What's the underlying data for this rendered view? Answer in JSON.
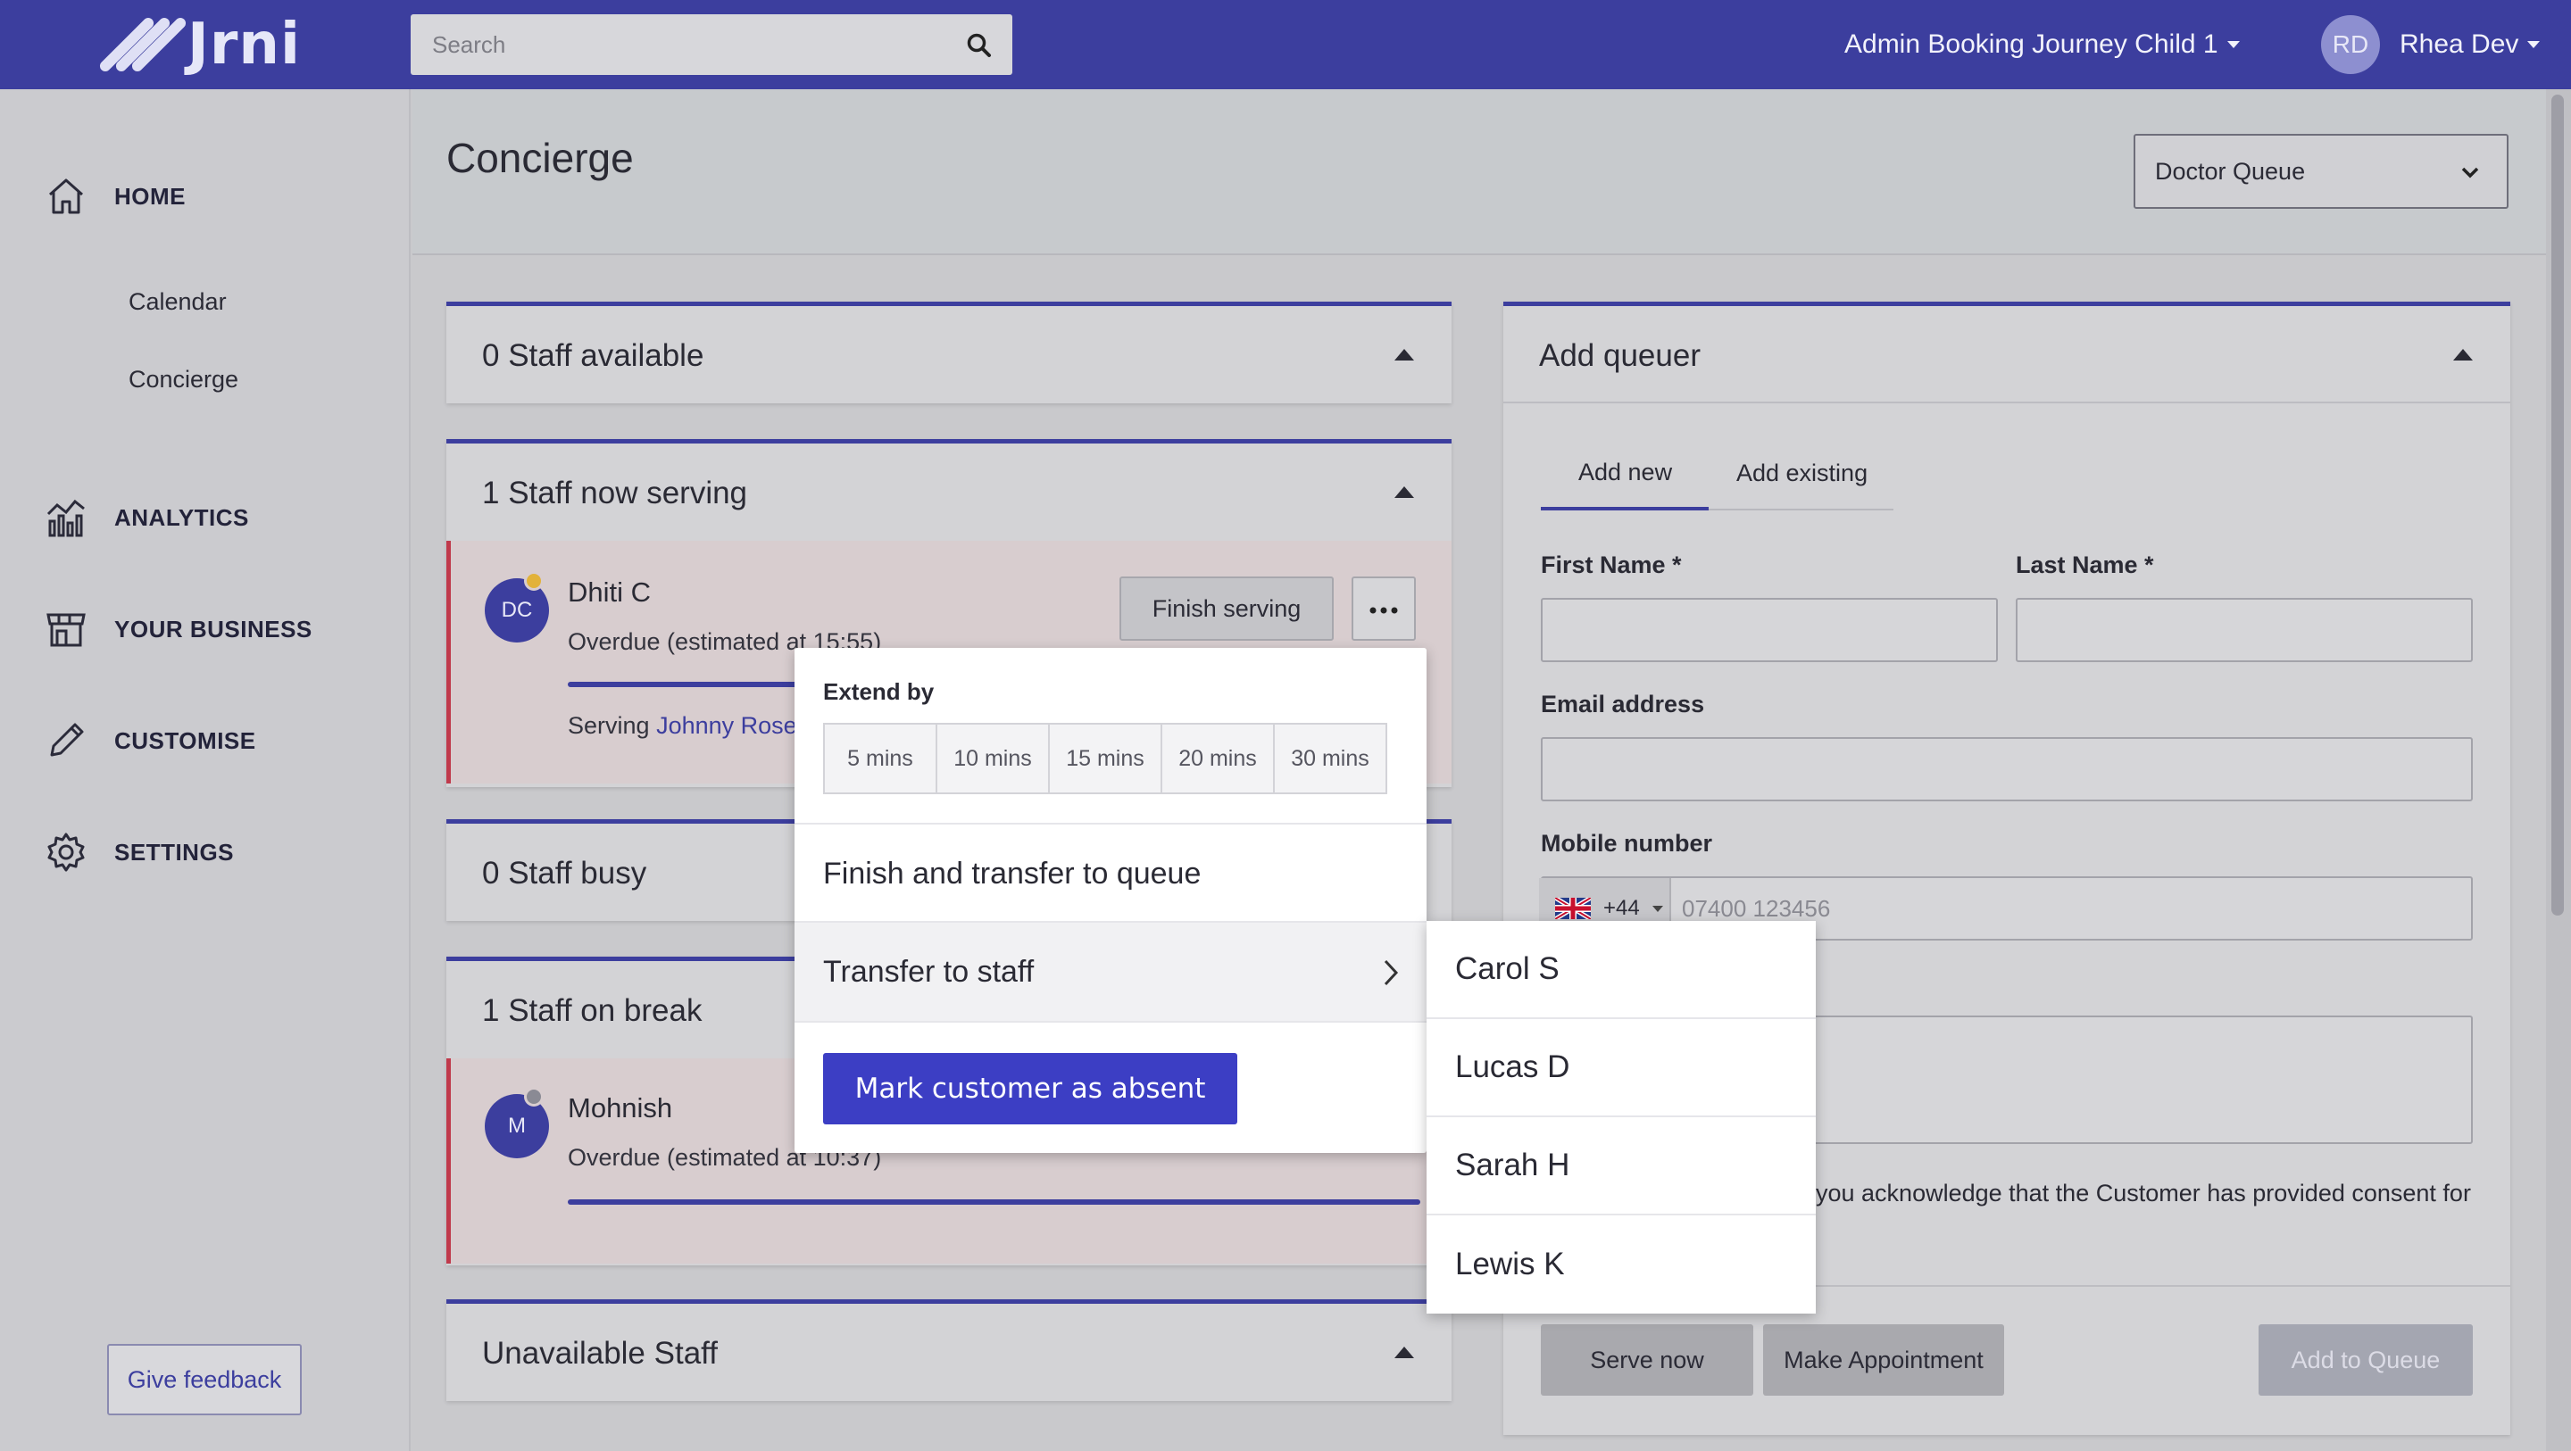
{
  "header": {
    "brand": "Jrni",
    "search_placeholder": "Search",
    "company": "Admin Booking Journey Child 1",
    "user_initials": "RD",
    "user_name": "Rhea Dev"
  },
  "sidebar": {
    "home": "HOME",
    "calendar": "Calendar",
    "concierge": "Concierge",
    "analytics": "ANALYTICS",
    "your_business": "YOUR BUSINESS",
    "customise": "CUSTOMISE",
    "settings": "SETTINGS",
    "feedback": "Give feedback"
  },
  "page": {
    "title": "Concierge",
    "queue_select": "Doctor Queue"
  },
  "panels": {
    "available": "0 Staff available",
    "serving": "1 Staff now serving",
    "busy": "0 Staff busy",
    "break": "1 Staff on break",
    "unavailable": "Unavailable Staff"
  },
  "serving_staff": {
    "initials": "DC",
    "name": "Dhiti C",
    "status": "Overdue (estimated at 15:55)",
    "serving_prefix": "Serving",
    "customer": "Johnny Rose",
    "finish_label": "Finish serving",
    "more_icon": "ellipsis-icon"
  },
  "break_staff": {
    "initials": "M",
    "name": "Mohnish",
    "status": "Overdue (estimated at 10:37)"
  },
  "menu": {
    "extend_label": "Extend by",
    "extend_options": [
      "5 mins",
      "10 mins",
      "15 mins",
      "20 mins",
      "30 mins"
    ],
    "finish_transfer": "Finish and transfer to queue",
    "transfer_staff": "Transfer to staff",
    "mark_absent": "Mark customer as absent",
    "staff_list": [
      "Carol S",
      "Lucas D",
      "Sarah H",
      "Lewis K"
    ]
  },
  "queuer": {
    "title": "Add queuer",
    "tab_new": "Add new",
    "tab_existing": "Add existing",
    "first_name": "First Name *",
    "last_name": "Last Name *",
    "email": "Email address",
    "mobile": "Mobile number",
    "dial_code": "+44",
    "phone_placeholder": "07400 123456",
    "consent_text": "you acknowledge that the Customer has provided consent for",
    "serve_now": "Serve now",
    "make_appointment": "Make Appointment",
    "add_to_queue": "Add to Queue"
  },
  "colors": {
    "brand": "#3c3e9e",
    "primary_button": "#3c3ec4",
    "overdue_border": "#c0394b"
  }
}
